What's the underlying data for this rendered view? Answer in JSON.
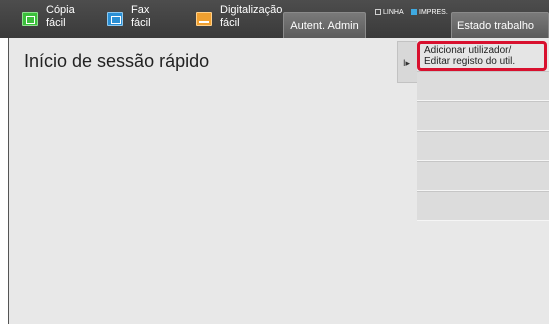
{
  "header": {
    "shortcuts": [
      {
        "label": "Cópia\nfácil",
        "icon": "copy-icon"
      },
      {
        "label": "Fax\nfácil",
        "icon": "fax-icon"
      },
      {
        "label": "Digitalização\nfácil",
        "icon": "scan-icon"
      }
    ],
    "admin_button": "Autent. Admin",
    "indicators": {
      "line": "LINHA",
      "print": "IMPRES."
    },
    "job_status_button": "Estado trabalho"
  },
  "main": {
    "title": "Início de sessão rápido"
  },
  "side_menu": {
    "handle_glyph": "I▸",
    "items": [
      {
        "label_line1": "Adicionar utilizador/",
        "label_line2": "Editar registo do util."
      }
    ]
  },
  "colors": {
    "highlight_border": "#d8102e",
    "print_indicator": "#3fa9e0"
  }
}
